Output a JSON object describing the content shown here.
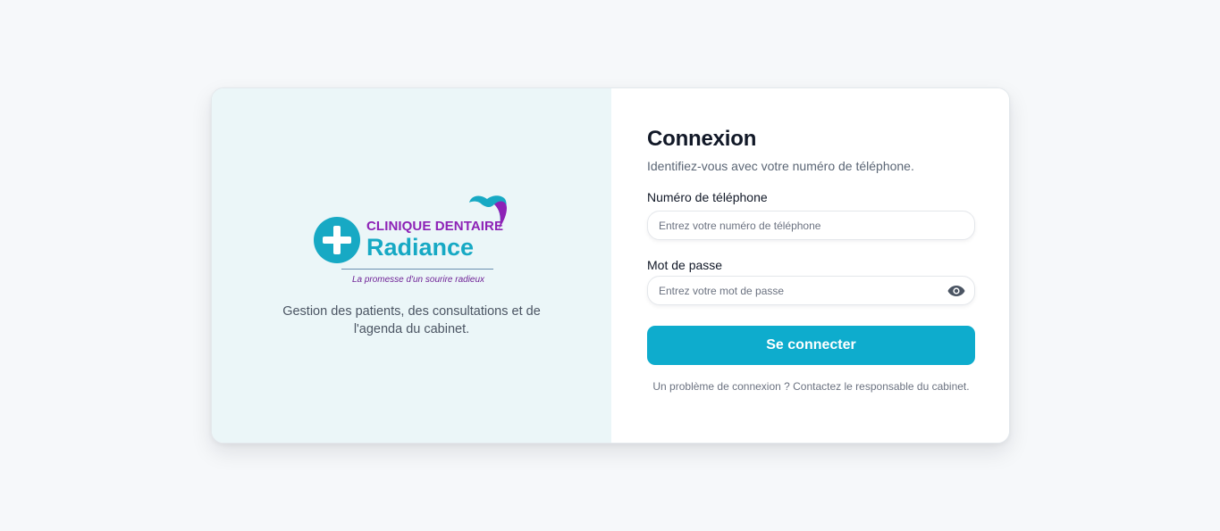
{
  "branding": {
    "name_top": "CLINIQUE DENTAIRE",
    "name_main": "Radiance",
    "tagline": "La promesse d'un sourire radieux",
    "description": "Gestion des patients, des consultations et de l'agenda du cabinet.",
    "icons": [
      "plus-icon",
      "tooth-icon"
    ],
    "colors": {
      "teal": "#17a9c4",
      "purple": "#8d22b6"
    }
  },
  "login": {
    "title": "Connexion",
    "subtitle": "Identifiez-vous avec votre numéro de téléphone.",
    "phone": {
      "label": "Numéro de téléphone",
      "placeholder": "Entrez votre numéro de téléphone",
      "value": ""
    },
    "password": {
      "label": "Mot de passe",
      "placeholder": "Entrez votre mot de passe",
      "value": "",
      "toggle_icon": "eye-icon"
    },
    "submit_label": "Se connecter",
    "help_text": "Un problème de connexion ? Contactez le responsable du cabinet.",
    "accent_color": "#0eaccd"
  }
}
